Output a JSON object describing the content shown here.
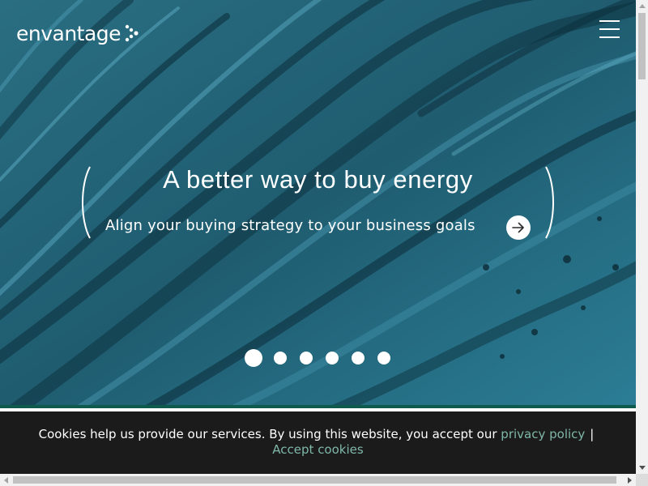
{
  "header": {
    "logo_text": "envantage",
    "menu_icon": "hamburger-menu-icon"
  },
  "hero": {
    "title": "A better way to buy energy",
    "subtitle": "Align your buying strategy to your business goals",
    "cta_icon": "arrow-right-icon",
    "slides": {
      "count": 6,
      "active": 1
    }
  },
  "cookie_banner": {
    "text": "Cookies help us provide our services. By using this website, you accept our",
    "privacy_link": "privacy policy",
    "separator": "|",
    "accept_link": "Accept cookies"
  },
  "colors": {
    "hero_base": "#1f5f73",
    "accent_link": "#7fb8a8",
    "banner_bg": "#1b1b1b",
    "strip_green": "#0e5b4e"
  }
}
